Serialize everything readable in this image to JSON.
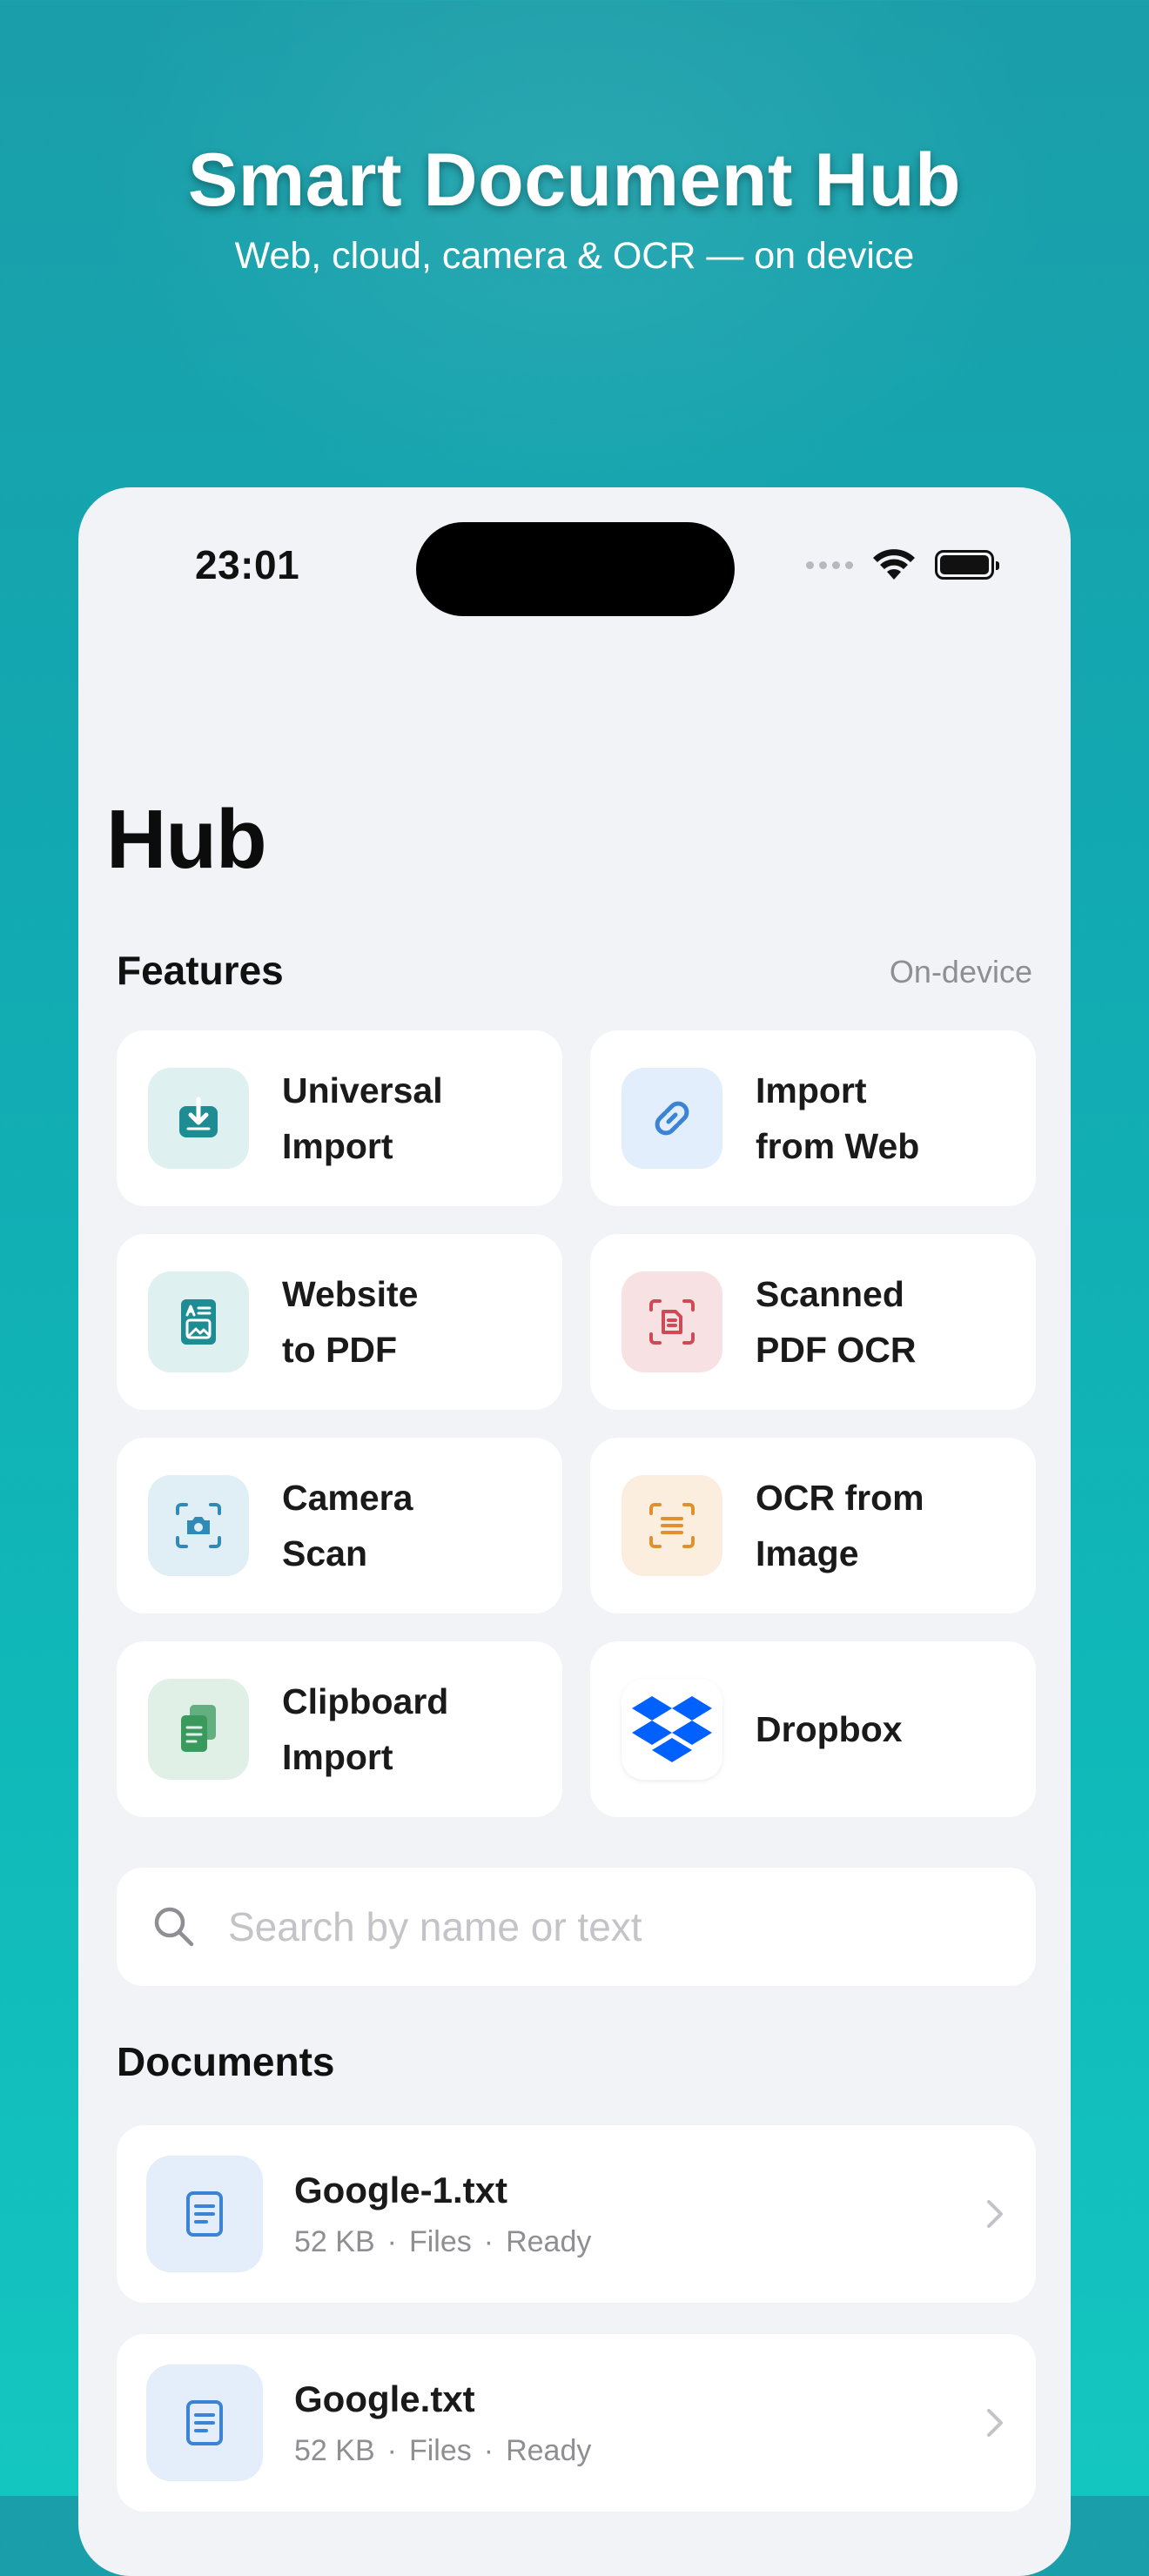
{
  "hero": {
    "title": "Smart Document Hub",
    "subtitle": "Web, cloud, camera & OCR — on device"
  },
  "status_bar": {
    "time": "23:01",
    "icons": [
      "signal-dots-icon",
      "wifi-icon",
      "battery-icon"
    ]
  },
  "page": {
    "title": "Hub"
  },
  "features": {
    "header": "Features",
    "badge": "On-device",
    "items": [
      {
        "label": "Universal\nImport",
        "icon": "download-tray-icon",
        "icon_bg": "#dff0f1",
        "icon_color": "#1e8c93"
      },
      {
        "label": "Import\nfrom Web",
        "icon": "link-icon",
        "icon_bg": "#e2eefb",
        "icon_color": "#3b83d6"
      },
      {
        "label": "Website\nto PDF",
        "icon": "webpage-icon",
        "icon_bg": "#dff0f1",
        "icon_color": "#1e8c93"
      },
      {
        "label": "Scanned\nPDF OCR",
        "icon": "scan-document-icon",
        "icon_bg": "#f8e1e3",
        "icon_color": "#cf4a55"
      },
      {
        "label": "Camera\nScan",
        "icon": "camera-scan-icon",
        "icon_bg": "#e0eff6",
        "icon_color": "#2f8bb6"
      },
      {
        "label": "OCR from\nImage",
        "icon": "text-scan-icon",
        "icon_bg": "#fbeede",
        "icon_color": "#e0902f"
      },
      {
        "label": "Clipboard\nImport",
        "icon": "clipboard-icon",
        "icon_bg": "#e0f0e6",
        "icon_color": "#3a9a5e"
      },
      {
        "label": "Dropbox",
        "icon": "dropbox-icon",
        "icon_bg": "#ffffff",
        "icon_color": "#0061fe"
      }
    ]
  },
  "search": {
    "placeholder": "Search by name or text",
    "value": ""
  },
  "documents": {
    "header": "Documents",
    "items": [
      {
        "name": "Google-1.txt",
        "size": "52 KB",
        "source": "Files",
        "status": "Ready"
      },
      {
        "name": "Google.txt",
        "size": "52 KB",
        "source": "Files",
        "status": "Ready"
      }
    ]
  }
}
